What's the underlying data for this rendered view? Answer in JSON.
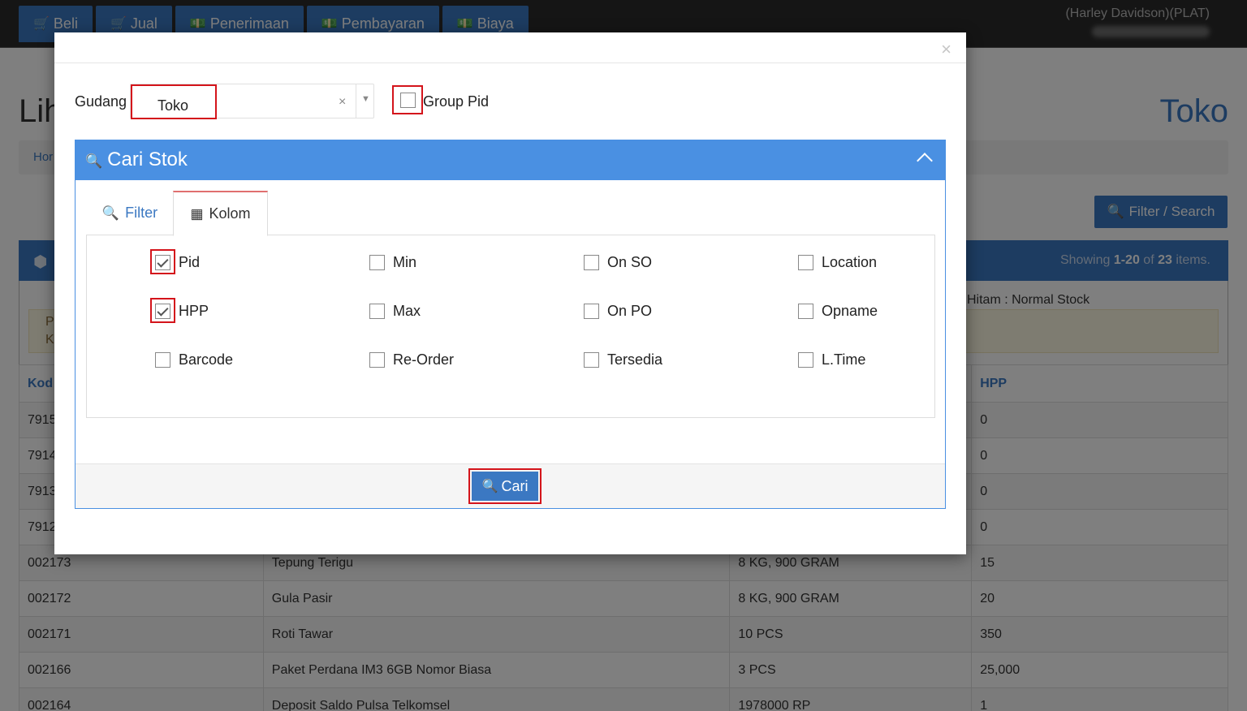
{
  "nav": {
    "tabs": [
      {
        "label": "Beli",
        "icon": "cart-icon"
      },
      {
        "label": "Jual",
        "icon": "cart-icon"
      },
      {
        "label": "Penerimaan",
        "icon": "money-icon"
      },
      {
        "label": "Pembayaran",
        "icon": "money-icon"
      },
      {
        "label": "Biaya",
        "icon": "money-icon"
      }
    ],
    "user_name": "(Harley Davidson)(PLAT)"
  },
  "page": {
    "title_partial": "Lih",
    "store": "Toko",
    "breadcrumb_partial": "Hor",
    "filter_search_label": "Filter / Search",
    "showing_prefix": "Showing ",
    "showing_range": "1-20",
    "showing_of": " of ",
    "showing_total": "23",
    "showing_suffix": " items.",
    "legend_text": "Hitam : Normal Stock",
    "warn_line1": "P",
    "warn_line2": "K",
    "table": {
      "headers": [
        "Kod",
        "",
        "",
        "HPP"
      ],
      "rows": [
        [
          "7915",
          "",
          "",
          "0"
        ],
        [
          "7914",
          "",
          "",
          "0"
        ],
        [
          "7913",
          "",
          "",
          "0"
        ],
        [
          "7912",
          "",
          "",
          "0"
        ],
        [
          "002173",
          "Tepung Terigu",
          "8 KG, 900 GRAM",
          "15"
        ],
        [
          "002172",
          "Gula Pasir",
          "8 KG, 900 GRAM",
          "20"
        ],
        [
          "002171",
          "Roti Tawar",
          "10 PCS",
          "350"
        ],
        [
          "002166",
          "Paket Perdana IM3 6GB Nomor Biasa",
          "3 PCS",
          "25,000"
        ],
        [
          "002164",
          "Deposit Saldo Pulsa Telkomsel",
          "1978000 RP",
          "1"
        ]
      ]
    }
  },
  "modal": {
    "close_symbol": "×",
    "gudang_label": "Gudang",
    "gudang_value": "Toko",
    "gudang_clear": "×",
    "gudang_arrow": "▼",
    "group_pid_label": "Group Pid",
    "panel_title": "Cari Stok",
    "tabs": {
      "filter": "Filter",
      "kolom": "Kolom"
    },
    "columns": [
      {
        "label": "Pid",
        "checked": true,
        "highlight": true
      },
      {
        "label": "Min",
        "checked": false,
        "highlight": false
      },
      {
        "label": "On SO",
        "checked": false,
        "highlight": false
      },
      {
        "label": "Location",
        "checked": false,
        "highlight": false
      },
      {
        "label": "HPP",
        "checked": true,
        "highlight": true
      },
      {
        "label": "Max",
        "checked": false,
        "highlight": false
      },
      {
        "label": "On PO",
        "checked": false,
        "highlight": false
      },
      {
        "label": "Opname",
        "checked": false,
        "highlight": false
      },
      {
        "label": "Barcode",
        "checked": false,
        "highlight": false
      },
      {
        "label": "Re-Order",
        "checked": false,
        "highlight": false
      },
      {
        "label": "Tersedia",
        "checked": false,
        "highlight": false
      },
      {
        "label": "L.Time",
        "checked": false,
        "highlight": false
      }
    ],
    "cari_label": "Cari"
  },
  "colors": {
    "primary": "#3b78c2",
    "panel_header": "#4a90e2",
    "highlight_red": "#d4141b",
    "navbar": "#2b2b2b"
  }
}
